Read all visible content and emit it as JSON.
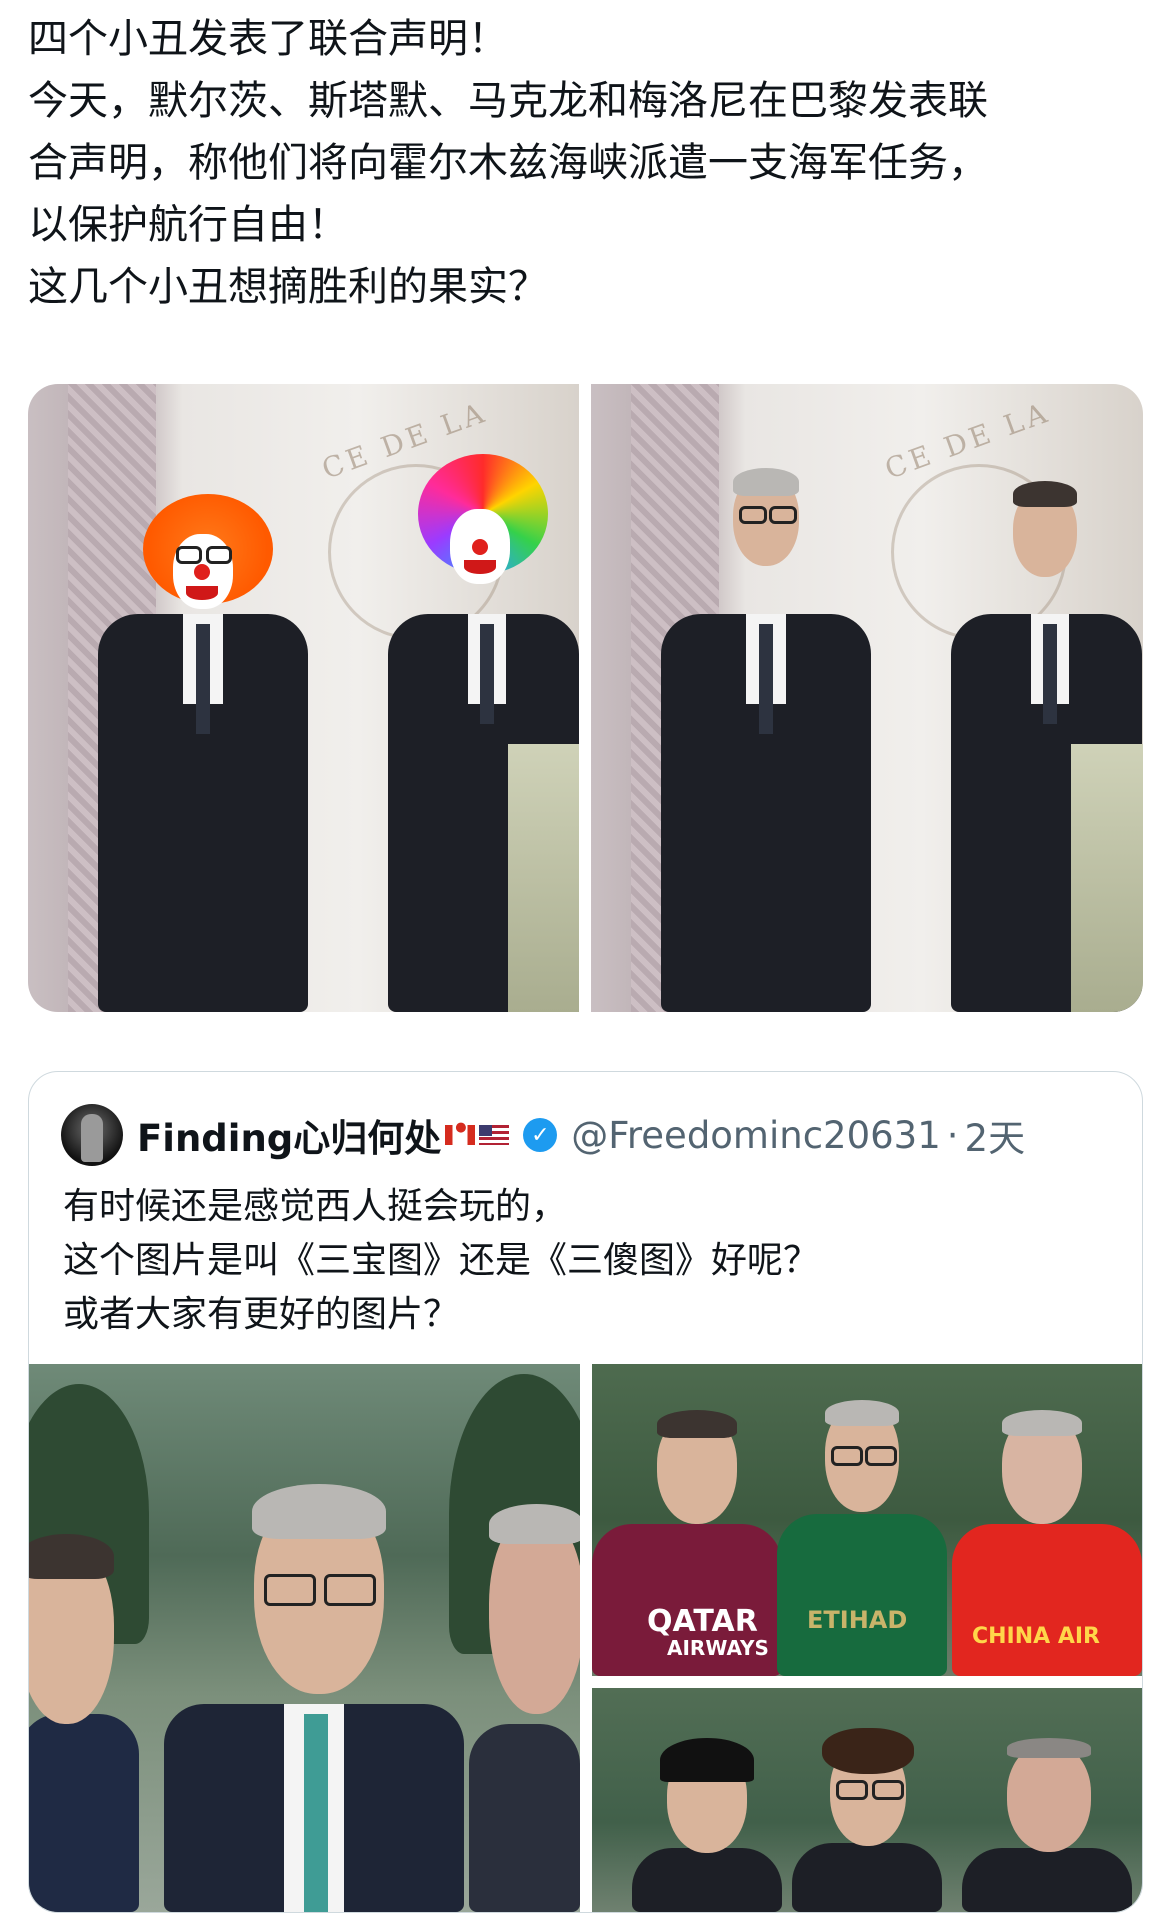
{
  "post": {
    "lines": [
      "四个小丑发表了联合声明！",
      "今天，默尔茨、斯塔默、马克龙和梅洛尼在巴黎发表联",
      "合声明，称他们将向霍尔木兹海峡派遣一支海军任务，",
      "以保护航行自由！",
      "这几个小丑想摘胜利的果实？"
    ]
  },
  "media_top": {
    "crest_text": "CE DE LA"
  },
  "quote": {
    "name": "Finding心归何处",
    "handle": "@Freedominc20631",
    "separator": "·",
    "time": "2天",
    "lines": [
      "有时候还是感觉西人挺会玩的，",
      "这个图片是叫《三宝图》还是《三傻图》好呢？",
      "或者大家有更好的图片？"
    ],
    "jersey_labels": {
      "qatar": "QATAR",
      "qatar_sub": "AIRWAYS",
      "etihad": "ETIHAD",
      "china_air": "CHINA AIR"
    }
  },
  "colors": {
    "verified": "#1d9bf0",
    "handle": "#536471",
    "card_border": "#cfd9de"
  }
}
